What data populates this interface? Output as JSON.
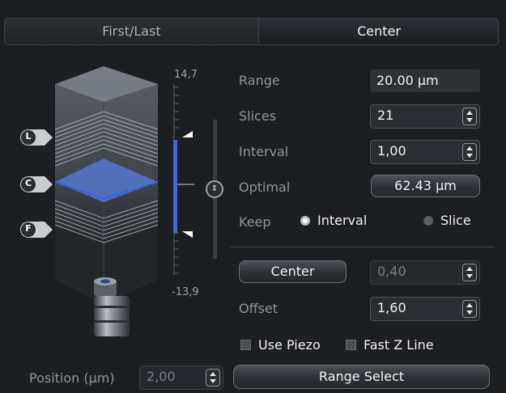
{
  "tabs": {
    "first_last": "First/Last",
    "center": "Center"
  },
  "scale": {
    "top": "14,7",
    "bottom": "-13,9"
  },
  "markers": {
    "last": "L",
    "center": "C",
    "first": "F"
  },
  "range": {
    "label": "Range",
    "value": "20.00 µm"
  },
  "slices": {
    "label": "Slices",
    "value": "21"
  },
  "interval": {
    "label": "Interval",
    "value": "1,00"
  },
  "optimal": {
    "label": "Optimal",
    "button": "62.43 µm"
  },
  "keep": {
    "label": "Keep",
    "interval": "Interval",
    "slice": "Slice",
    "selected": "Interval"
  },
  "center_row": {
    "button": "Center",
    "value": "0,40"
  },
  "offset": {
    "label": "Offset",
    "value": "1,60"
  },
  "checkboxes": {
    "use_piezo": "Use Piezo",
    "fast_z_line": "Fast Z Line"
  },
  "position": {
    "label": "Position (µm)",
    "value": "2,00"
  },
  "range_select": {
    "label": "Range Select"
  },
  "colors": {
    "accent": "#3a68e0",
    "panel": "#1c1e21",
    "field": "#2d3136"
  }
}
